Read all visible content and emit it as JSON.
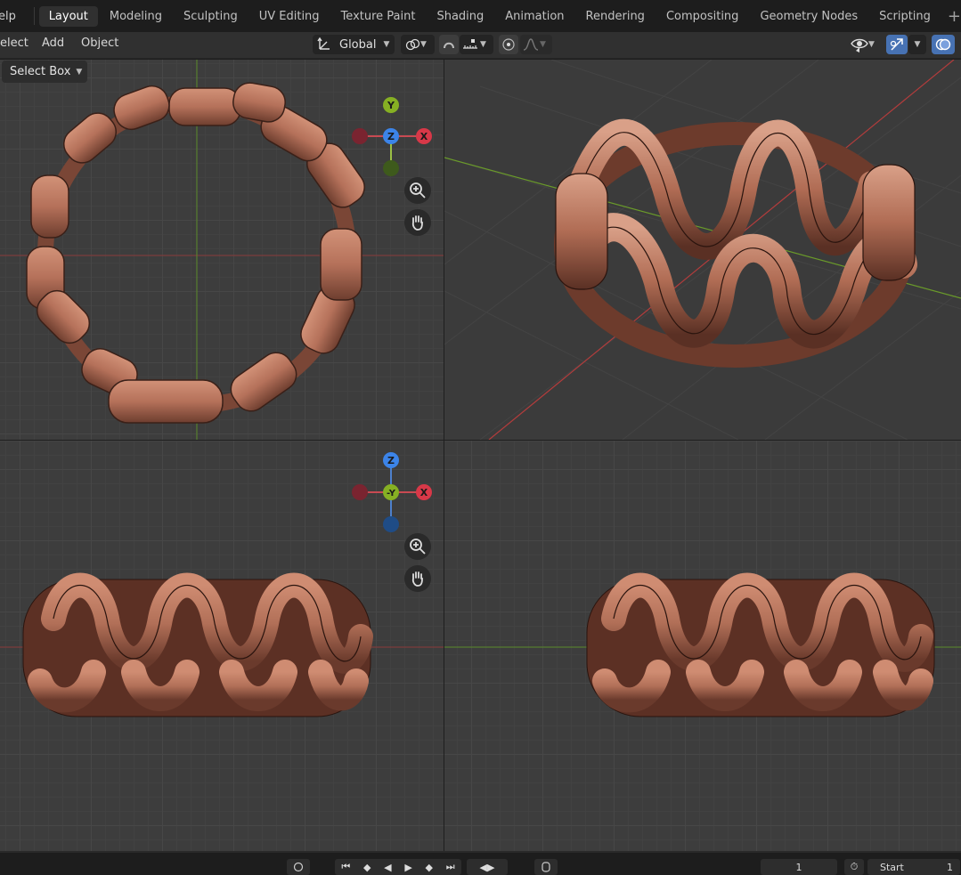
{
  "topbar": {
    "menu_fragment": "elp",
    "tabs": [
      {
        "label": "Layout",
        "active": true
      },
      {
        "label": "Modeling"
      },
      {
        "label": "Sculpting"
      },
      {
        "label": "UV Editing"
      },
      {
        "label": "Texture Paint"
      },
      {
        "label": "Shading"
      },
      {
        "label": "Animation"
      },
      {
        "label": "Rendering"
      },
      {
        "label": "Compositing"
      },
      {
        "label": "Geometry Nodes"
      },
      {
        "label": "Scripting"
      }
    ],
    "add_icon": "plus-icon"
  },
  "header": {
    "select_menu": "elect",
    "add_menu": "Add",
    "object_menu": "Object",
    "transform_orientation": "Global",
    "icons": [
      "transform-orientation-icon",
      "pivot-icon",
      "snap-icon",
      "snap-increment-icon",
      "proportional-edit-icon",
      "falloff-icon",
      "visibility-icon",
      "gizmo-icon",
      "overlay-icon"
    ]
  },
  "tool": {
    "select_mode": "Select Box"
  },
  "viewports": {
    "top_left": {
      "gizmo_labels": [
        "Y",
        "Z",
        "X"
      ],
      "axis_color_x": "#c8303a",
      "axis_color_y": "#80b020",
      "axis_color_z": "#3a80e0"
    },
    "bottom_left": {
      "gizmo_labels": [
        "Z",
        "-Y",
        "X"
      ]
    }
  },
  "timeline": {
    "current_frame": "1",
    "start_label": "Start",
    "start_value": "1"
  },
  "colors": {
    "accent": "#4772b3",
    "copper": "#b87358"
  }
}
